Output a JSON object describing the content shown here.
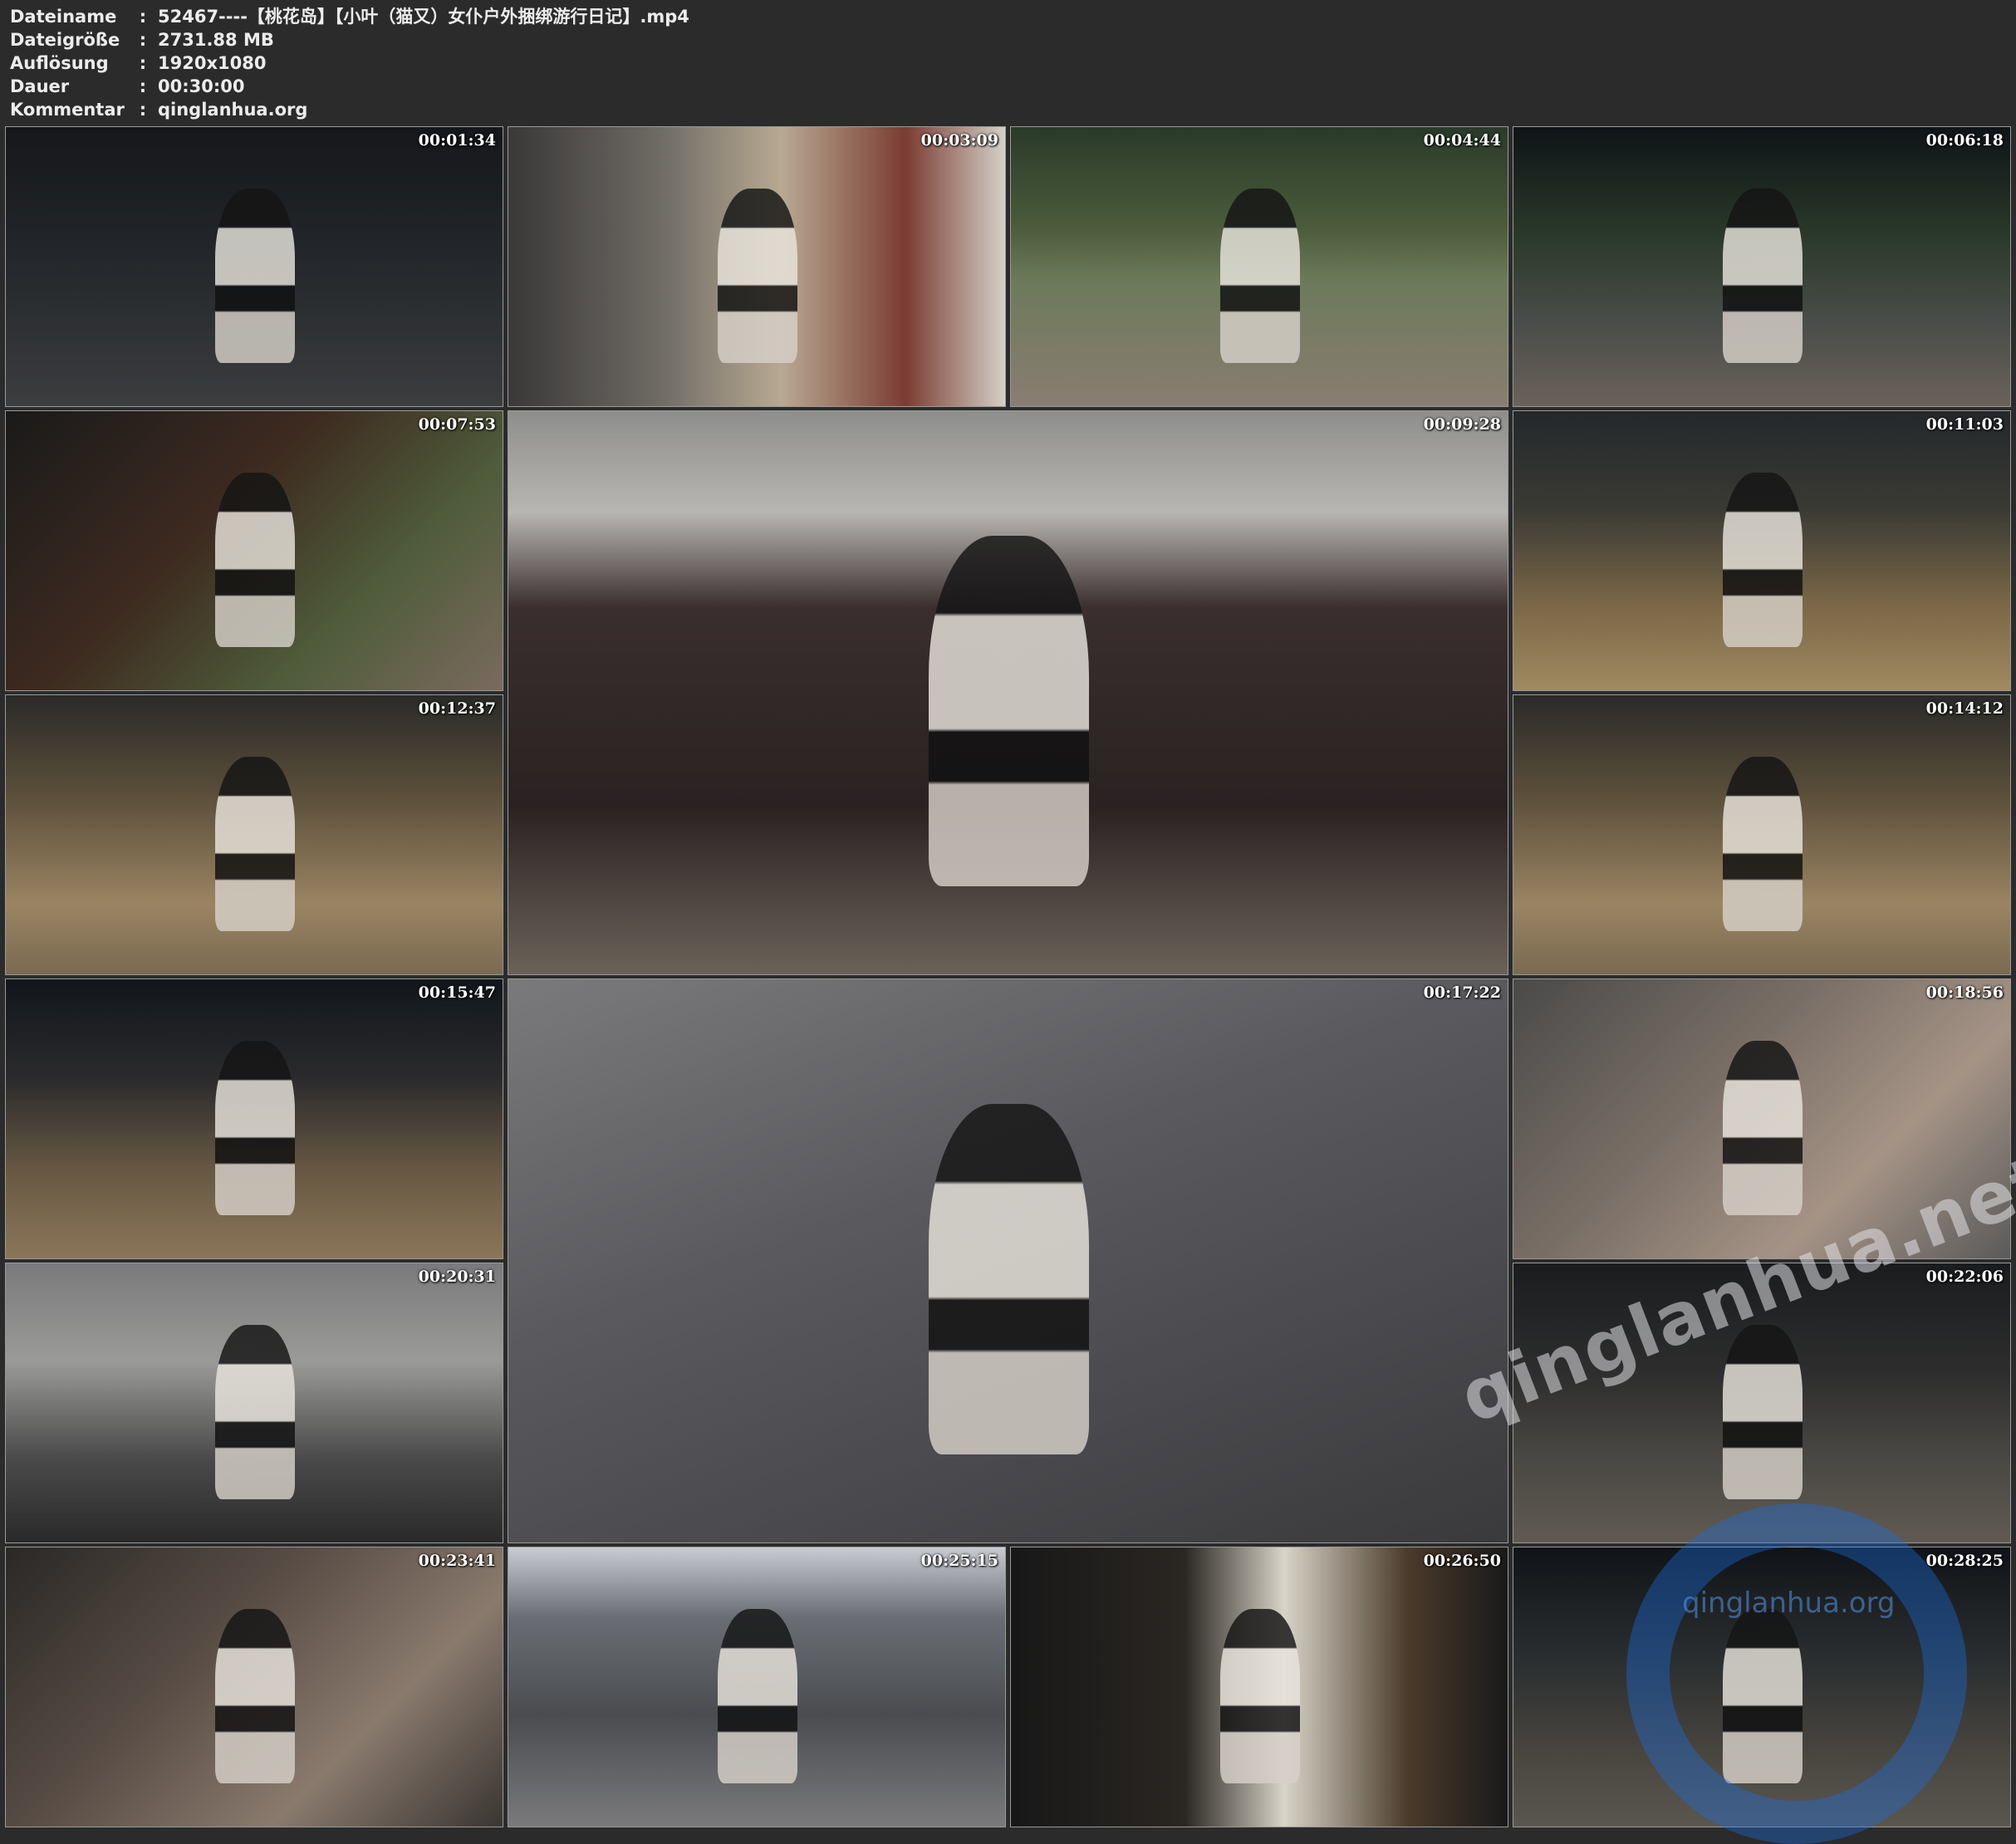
{
  "header": {
    "rows": [
      {
        "label": "Dateiname",
        "value": "52467----【桃花岛】【小叶（猫又）女仆户外捆绑游行日记】.mp4"
      },
      {
        "label": "Dateigröße",
        "value": "2731.88 MB"
      },
      {
        "label": "Auflösung",
        "value": "1920x1080"
      },
      {
        "label": "Dauer",
        "value": "00:30:00"
      },
      {
        "label": "Kommentar",
        "value": "qinglanhua.org"
      }
    ],
    "separator": ":"
  },
  "thumbnails": [
    {
      "timestamp": "00:01:34",
      "scene": "night-street"
    },
    {
      "timestamp": "00:03:09",
      "scene": "convenience-store"
    },
    {
      "timestamp": "00:04:44",
      "scene": "roadside-sidewalk"
    },
    {
      "timestamp": "00:06:18",
      "scene": "night-sidewalk"
    },
    {
      "timestamp": "00:07:53",
      "scene": "close-up-walkway"
    },
    {
      "timestamp": "00:09:28",
      "scene": "parked-car"
    },
    {
      "timestamp": "00:11:03",
      "scene": "brick-walkway"
    },
    {
      "timestamp": "00:12:37",
      "scene": "brick-walkway-legs"
    },
    {
      "timestamp": "00:14:12",
      "scene": "brick-walkway-legs"
    },
    {
      "timestamp": "00:15:47",
      "scene": "footbridge"
    },
    {
      "timestamp": "00:17:22",
      "scene": "sitting-on-pavement"
    },
    {
      "timestamp": "00:18:56",
      "scene": "blurry-close-up"
    },
    {
      "timestamp": "00:20:31",
      "scene": "railing-rope"
    },
    {
      "timestamp": "00:22:06",
      "scene": "railing-sitting"
    },
    {
      "timestamp": "00:23:41",
      "scene": "close-up-head"
    },
    {
      "timestamp": "00:25:15",
      "scene": "plaza-walk"
    },
    {
      "timestamp": "00:26:50",
      "scene": "shopfront-night"
    },
    {
      "timestamp": "00:28:25",
      "scene": "street-night"
    }
  ],
  "watermarks": {
    "diagonal_text": "qinglanhua.net",
    "logo_text": "qinglanhua.org",
    "logo_icon": "circle-logo-icon"
  },
  "colors": {
    "background": "#2b2b2b",
    "header_text": "#ececec",
    "timestamp_text": "#ffffff",
    "watermark_logo": "#1e6ee1"
  }
}
